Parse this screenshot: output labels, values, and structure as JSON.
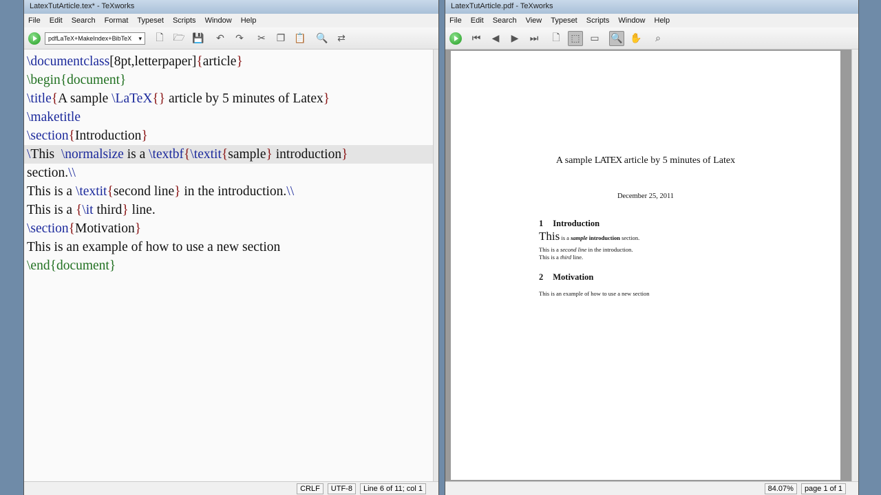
{
  "editor_window": {
    "title": "LatexTutArticle.tex* - TeXworks",
    "menu": [
      "File",
      "Edit",
      "Search",
      "Format",
      "Typeset",
      "Scripts",
      "Window",
      "Help"
    ],
    "typeset_option": "pdfLaTeX+MakeIndex+BibTeX",
    "lines": [
      [
        {
          "t": "\\documentclass",
          "c": "cmd"
        },
        {
          "t": "[8pt,letterpaper]",
          "c": ""
        },
        {
          "t": "{",
          "c": "br"
        },
        {
          "t": "article",
          "c": ""
        },
        {
          "t": "}",
          "c": "br"
        }
      ],
      [
        {
          "t": "\\begin",
          "c": "env"
        },
        {
          "t": "{",
          "c": "env"
        },
        {
          "t": "document",
          "c": "env"
        },
        {
          "t": "}",
          "c": "env"
        }
      ],
      [
        {
          "t": "\\title",
          "c": "cmd"
        },
        {
          "t": "{",
          "c": "br"
        },
        {
          "t": "A sample ",
          "c": ""
        },
        {
          "t": "\\LaTeX",
          "c": "cmd"
        },
        {
          "t": "{}",
          "c": "br"
        },
        {
          "t": " article by 5 minutes of Latex",
          "c": ""
        },
        {
          "t": "}",
          "c": "br"
        }
      ],
      [
        {
          "t": "\\maketitle",
          "c": "cmd"
        }
      ],
      [
        {
          "t": "\\section",
          "c": "cmd"
        },
        {
          "t": "{",
          "c": "br"
        },
        {
          "t": "Introduction",
          "c": ""
        },
        {
          "t": "}",
          "c": "br"
        }
      ],
      [
        {
          "t": "\\",
          "c": "cmd"
        },
        {
          "t": "This  ",
          "c": ""
        },
        {
          "t": "\\normalsize",
          "c": "cmd"
        },
        {
          "t": " is a ",
          "c": ""
        },
        {
          "t": "\\textbf",
          "c": "cmd"
        },
        {
          "t": "{",
          "c": "br"
        },
        {
          "t": "\\textit",
          "c": "cmd"
        },
        {
          "t": "{",
          "c": "br"
        },
        {
          "t": "sample",
          "c": ""
        },
        {
          "t": "}",
          "c": "br"
        },
        {
          "t": " introduction",
          "c": ""
        },
        {
          "t": "}",
          "c": "br"
        }
      ],
      [
        {
          "t": "section.",
          "c": ""
        },
        {
          "t": "\\\\",
          "c": "cmd"
        }
      ],
      [
        {
          "t": "This is a ",
          "c": ""
        },
        {
          "t": "\\textit",
          "c": "cmd"
        },
        {
          "t": "{",
          "c": "br"
        },
        {
          "t": "second line",
          "c": ""
        },
        {
          "t": "}",
          "c": "br"
        },
        {
          "t": " in the introduction.",
          "c": ""
        },
        {
          "t": "\\\\",
          "c": "cmd"
        }
      ],
      [
        {
          "t": "This is a ",
          "c": ""
        },
        {
          "t": "{",
          "c": "br"
        },
        {
          "t": "\\it",
          "c": "cmd"
        },
        {
          "t": " third",
          "c": ""
        },
        {
          "t": "}",
          "c": "br"
        },
        {
          "t": " line.",
          "c": ""
        }
      ],
      [
        {
          "t": "\\section",
          "c": "cmd"
        },
        {
          "t": "{",
          "c": "br"
        },
        {
          "t": "Motivation",
          "c": ""
        },
        {
          "t": "}",
          "c": "br"
        }
      ],
      [
        {
          "t": "This is an example of how to use a new section",
          "c": ""
        }
      ],
      [
        {
          "t": "\\end",
          "c": "env"
        },
        {
          "t": "{",
          "c": "env"
        },
        {
          "t": "document",
          "c": "env"
        },
        {
          "t": "}",
          "c": "env"
        }
      ]
    ],
    "current_line_index": 5,
    "status": {
      "line_ending": "CRLF",
      "encoding": "UTF-8",
      "position": "Line 6 of 11; col 1"
    }
  },
  "pdf_window": {
    "title": "LatexTutArticle.pdf - TeXworks",
    "menu": [
      "File",
      "Edit",
      "Search",
      "View",
      "Typeset",
      "Scripts",
      "Window",
      "Help"
    ],
    "document": {
      "title_prefix": "A sample ",
      "title_logo": "LATEX",
      "title_suffix": " article by 5 minutes of Latex",
      "date": "December 25, 2011",
      "sections": [
        {
          "num": "1",
          "title": "Introduction"
        },
        {
          "num": "2",
          "title": "Motivation"
        }
      ],
      "intro_big": "This",
      "intro_rest_1": " is a ",
      "intro_bold_italic": "sample",
      "intro_bold": " introduction",
      "intro_rest_2": " section.",
      "line2_a": "This is a ",
      "line2_italic": "second line",
      "line2_b": " in the introduction.",
      "line3_a": "This is a ",
      "line3_italic": "third",
      "line3_b": " line.",
      "motivation_text": "This is an example of how to use a new section"
    },
    "status": {
      "zoom": "84.07%",
      "page": "page 1 of 1"
    }
  }
}
